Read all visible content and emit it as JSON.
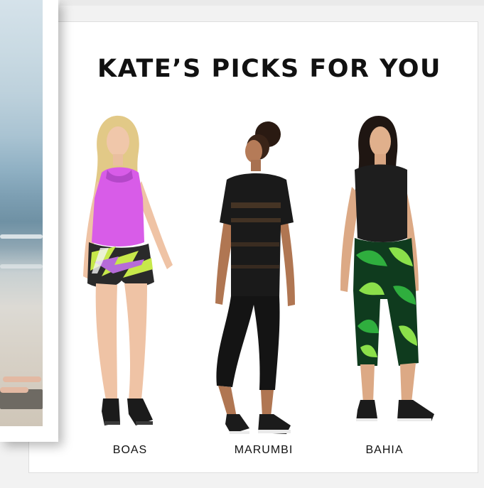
{
  "section": {
    "title": "KATE’S PICKS FOR YOU"
  },
  "products": [
    {
      "name": "BOAS",
      "tank_color": "#d85ce8",
      "shorts_colors": [
        "#2a2a2a",
        "#c7e84a",
        "#b66bd8",
        "#f4f4f4"
      ]
    },
    {
      "name": "MARUMBI",
      "top_color": "#1a1a1a",
      "legging_color": "#141414"
    },
    {
      "name": "BAHIA",
      "top_color": "#1e1e1e",
      "pant_colors": [
        "#0f3b1e",
        "#2fae3e",
        "#8be04a"
      ]
    }
  ]
}
